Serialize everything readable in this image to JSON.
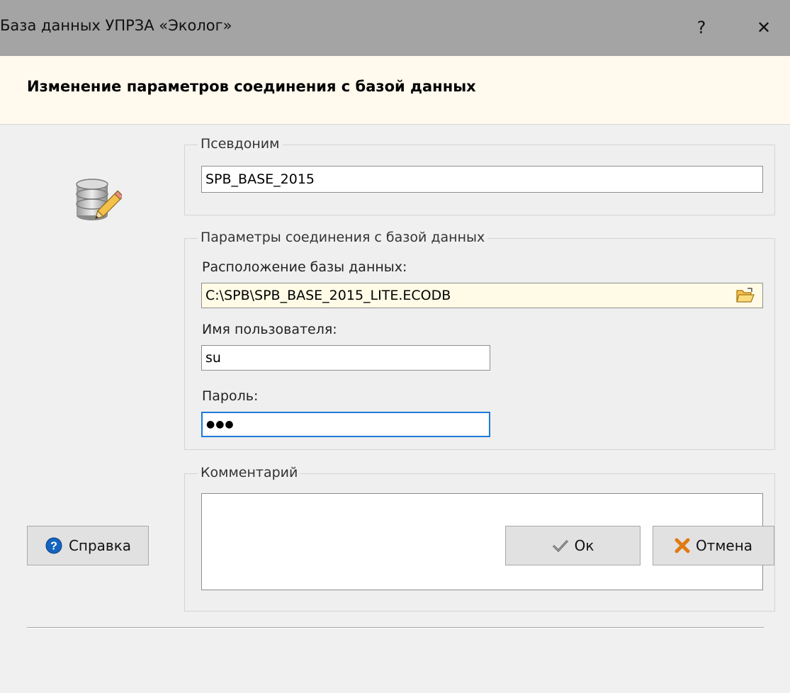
{
  "window": {
    "title": "База данных УПРЗА «Эколог»",
    "help_glyph": "?",
    "close_glyph": "✕"
  },
  "header": {
    "title": "Изменение параметров соединения с базой данных"
  },
  "alias_group": {
    "legend": "Псевдоним",
    "value": "SPB_BASE_2015"
  },
  "connection_group": {
    "legend": "Параметры соединения с базой данных",
    "location_label": "Расположение базы данных:",
    "location_value": "C:\\SPB\\SPB_BASE_2015_LITE.ECODB",
    "username_label": "Имя пользователя:",
    "username_value": "su",
    "password_label": "Пароль:",
    "password_value": "●●●"
  },
  "comment_group": {
    "legend": "Комментарий",
    "value": ""
  },
  "buttons": {
    "help": "Справка",
    "ok": "Ок",
    "cancel": "Отмена"
  },
  "colors": {
    "titlebar": "#a4a4a4",
    "header_bg": "#fff9ee",
    "location_bg": "#fffbe6",
    "focus_border": "#1f7ad8",
    "help_icon": "#1565c0",
    "cancel_icon": "#e07a12"
  }
}
